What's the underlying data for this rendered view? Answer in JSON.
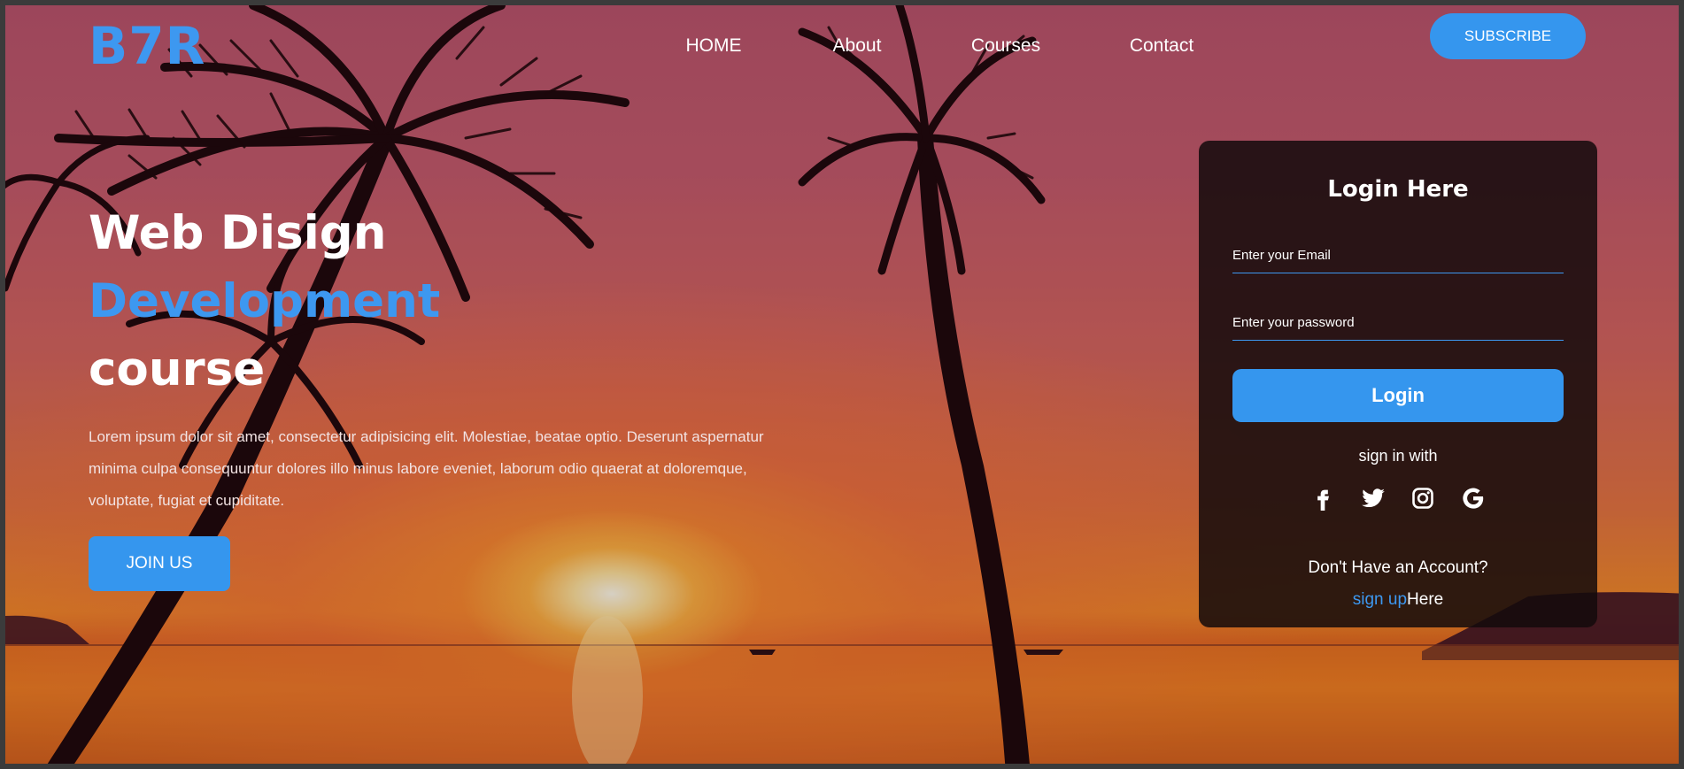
{
  "brand": {
    "logo": "B7R"
  },
  "nav": {
    "items": [
      {
        "label": "HOME"
      },
      {
        "label": "About"
      },
      {
        "label": "Courses"
      },
      {
        "label": "Contact"
      }
    ],
    "subscribe_label": "SUBSCRIBE"
  },
  "hero": {
    "title_line1": "Web Disign",
    "title_line2": "Development",
    "title_line3": "course",
    "description": "Lorem ipsum dolor sit amet, consectetur adipisicing elit. Molestiae, beatae optio. Deserunt aspernatur minima culpa consequuntur dolores illo minus labore eveniet, laborum odio quaerat at doloremque, voluptate, fugiat et cupiditate.",
    "join_label": "JOIN US"
  },
  "login": {
    "title": "Login Here",
    "email_placeholder": "Enter your Email",
    "password_placeholder": "Enter your password",
    "button_label": "Login",
    "sign_in_with": "sign in with",
    "social_icons": [
      "facebook-icon",
      "twitter-icon",
      "instagram-icon",
      "google-icon"
    ],
    "no_account": "Don't Have an Account?",
    "signup_link": "sign up",
    "signup_suffix": "Here"
  },
  "colors": {
    "accent": "#3596ee",
    "card_bg": "#140a0c"
  }
}
